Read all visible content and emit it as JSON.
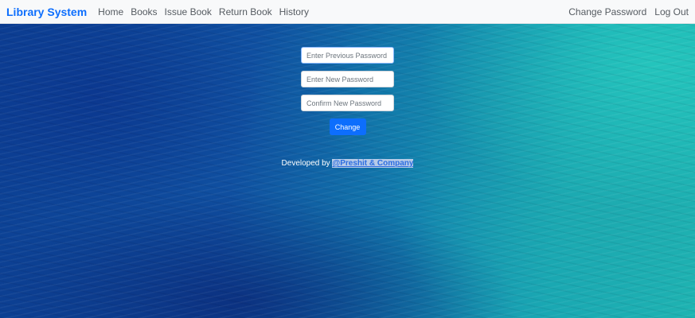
{
  "navbar": {
    "brand": "Library System",
    "links": [
      "Home",
      "Books",
      "Issue Book",
      "Return Book",
      "History"
    ],
    "right_links": [
      "Change Password",
      "Log Out"
    ]
  },
  "form": {
    "previous_password_placeholder": "Enter Previous Password",
    "new_password_placeholder": "Enter New Password",
    "confirm_password_placeholder": "Confirm New Password",
    "submit_label": "Change"
  },
  "footer": {
    "prefix": "Developed by",
    "credit": "@Preshit & Company"
  },
  "colors": {
    "brand": "#0d6efd",
    "navbar_bg": "#f8f9fa",
    "button_bg": "#0d6efd"
  }
}
